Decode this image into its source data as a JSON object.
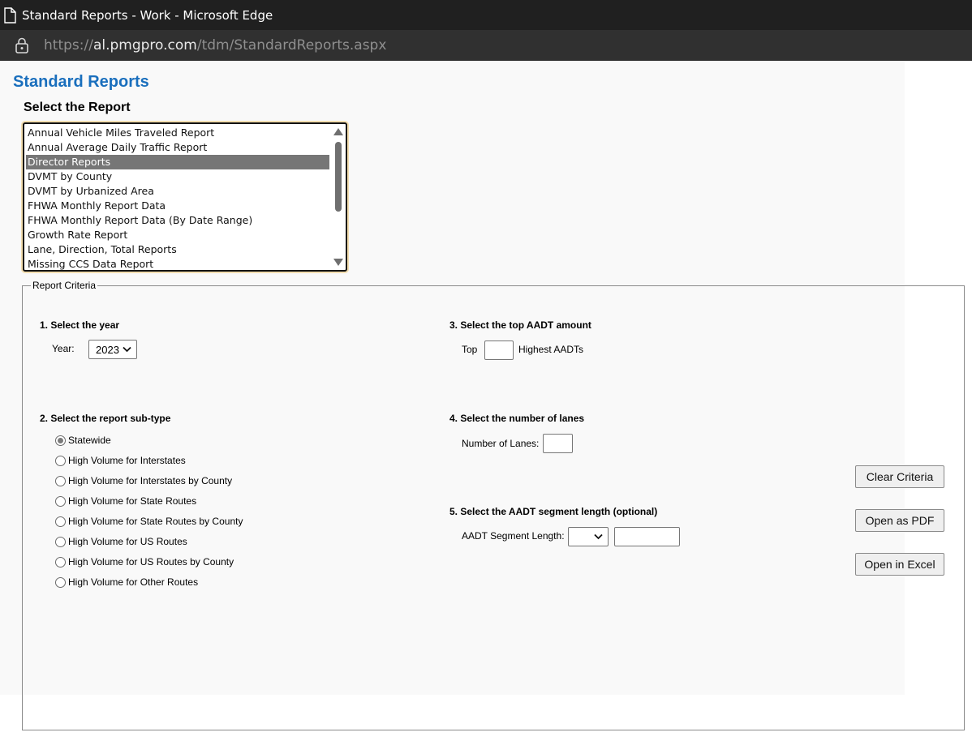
{
  "browser": {
    "window_title": "Standard Reports - Work - Microsoft Edge",
    "url_scheme": "https://",
    "url_host": "al.pmgpro.com",
    "url_path": "/tdm/StandardReports.aspx"
  },
  "page": {
    "title": "Standard Reports",
    "select_heading": "Select the Report"
  },
  "report_list": {
    "items": [
      "Annual Vehicle Miles Traveled Report",
      "Annual Average Daily Traffic Report",
      "Director Reports",
      "DVMT by County",
      "DVMT by Urbanized Area",
      "FHWA Monthly Report Data",
      "FHWA Monthly Report Data (By Date Range)",
      "Growth Rate Report",
      "Lane, Direction, Total Reports",
      "Missing CCS Data Report"
    ],
    "selected": "Director Reports"
  },
  "criteria": {
    "legend": "Report Criteria",
    "year": {
      "heading": "1. Select the year",
      "label": "Year:",
      "value": "2023"
    },
    "subtype": {
      "heading": "2. Select the report sub-type",
      "options": [
        "Statewide",
        "High Volume for Interstates",
        "High Volume for Interstates by County",
        "High Volume for State Routes",
        "High Volume for State Routes by County",
        "High Volume for US Routes",
        "High Volume for US Routes by County",
        "High Volume for Other Routes"
      ],
      "selected": "Statewide"
    },
    "top_aadt": {
      "heading": "3. Select the top AADT amount",
      "prefix": "Top",
      "suffix": "Highest AADTs",
      "value": ""
    },
    "lanes": {
      "heading": "4. Select the number of lanes",
      "label": "Number of Lanes:",
      "value": ""
    },
    "segment": {
      "heading": "5. Select the AADT segment length (optional)",
      "label": "AADT Segment Length:",
      "operator_value": "",
      "length_value": ""
    }
  },
  "buttons": {
    "clear": "Clear Criteria",
    "pdf": "Open as PDF",
    "excel": "Open in Excel"
  },
  "icons": {
    "page": "page-icon",
    "lock": "lock-icon",
    "chevron": "chevron-down-icon"
  }
}
